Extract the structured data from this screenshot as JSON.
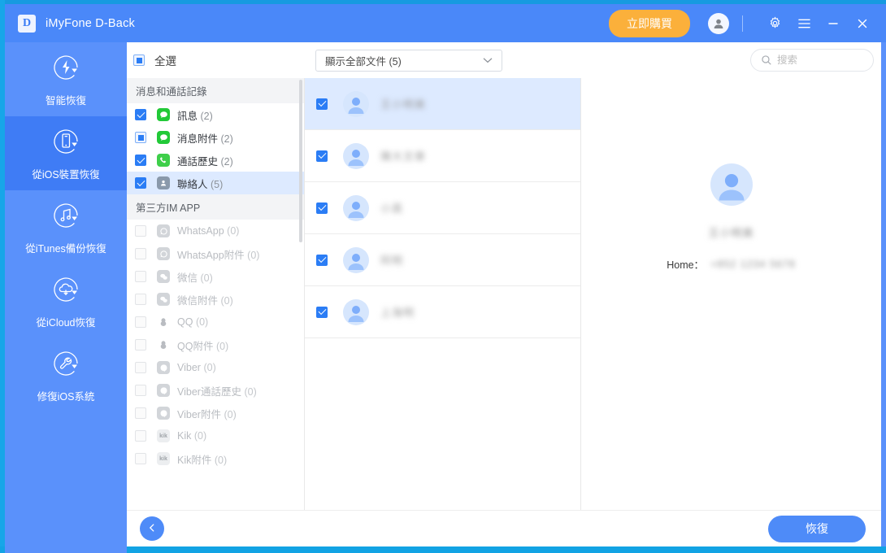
{
  "window": {
    "app_title": "iMyFone D-Back",
    "logo_letter": "D",
    "buy_label": "立即購買",
    "account_icon": "account-icon",
    "settings_icon": "gear-icon",
    "menu_icon": "menu-icon",
    "minimize_icon": "minimize-icon",
    "close_icon": "close-icon"
  },
  "sidebar": {
    "items": [
      {
        "label": "智能恢復",
        "icon": "smart-recovery-icon",
        "active": false
      },
      {
        "label": "從iOS裝置恢復",
        "icon": "ios-device-icon",
        "active": true
      },
      {
        "label": "從iTunes備份恢復",
        "icon": "itunes-backup-icon",
        "active": false
      },
      {
        "label": "從iCloud恢復",
        "icon": "icloud-icon",
        "active": false
      },
      {
        "label": "修復iOS系統",
        "icon": "repair-wrench-icon",
        "active": false
      }
    ]
  },
  "toolbar": {
    "select_all_label": "全選",
    "select_all_state": "indeterminate",
    "filter_label": "顯示全部文件 (5)",
    "filter_caret_icon": "chevron-down-icon",
    "search_placeholder": "搜索",
    "search_value": "",
    "search_icon": "search-icon"
  },
  "file_types": {
    "groups": [
      {
        "title": "消息和通話記錄",
        "rows": [
          {
            "label": "訊息",
            "count": "(2)",
            "state": "checked",
            "disabled": false,
            "selected": false,
            "icon": "message-bubble-icon",
            "icon_color": "#22c938"
          },
          {
            "label": "消息附件",
            "count": "(2)",
            "state": "indeterminate",
            "disabled": false,
            "selected": false,
            "icon": "message-bubble-icon",
            "icon_color": "#22c938"
          },
          {
            "label": "通話歷史",
            "count": "(2)",
            "state": "checked",
            "disabled": false,
            "selected": false,
            "icon": "phone-icon",
            "icon_color": "#3ecf4a"
          },
          {
            "label": "聯絡人",
            "count": "(5)",
            "state": "checked",
            "disabled": false,
            "selected": true,
            "icon": "contacts-icon",
            "icon_color": "#8a99ab"
          }
        ]
      },
      {
        "title": "第三方IM APP",
        "rows": [
          {
            "label": "WhatsApp",
            "count": "(0)",
            "state": "off",
            "disabled": true,
            "selected": false,
            "icon": "whatsapp-icon",
            "icon_color": "#c9ccd1"
          },
          {
            "label": "WhatsApp附件",
            "count": "(0)",
            "state": "off",
            "disabled": true,
            "selected": false,
            "icon": "whatsapp-icon",
            "icon_color": "#c9ccd1"
          },
          {
            "label": "微信",
            "count": "(0)",
            "state": "off",
            "disabled": true,
            "selected": false,
            "icon": "wechat-icon",
            "icon_color": "#c9ccd1"
          },
          {
            "label": "微信附件",
            "count": "(0)",
            "state": "off",
            "disabled": true,
            "selected": false,
            "icon": "wechat-icon",
            "icon_color": "#c9ccd1"
          },
          {
            "label": "QQ",
            "count": "(0)",
            "state": "off",
            "disabled": true,
            "selected": false,
            "icon": "qq-penguin-icon",
            "icon_color": "#b9bcc1"
          },
          {
            "label": "QQ附件",
            "count": "(0)",
            "state": "off",
            "disabled": true,
            "selected": false,
            "icon": "qq-penguin-icon",
            "icon_color": "#b9bcc1"
          },
          {
            "label": "Viber",
            "count": "(0)",
            "state": "off",
            "disabled": true,
            "selected": false,
            "icon": "viber-icon",
            "icon_color": "#c9ccd1"
          },
          {
            "label": "Viber通話歷史",
            "count": "(0)",
            "state": "off",
            "disabled": true,
            "selected": false,
            "icon": "viber-icon",
            "icon_color": "#c9ccd1"
          },
          {
            "label": "Viber附件",
            "count": "(0)",
            "state": "off",
            "disabled": true,
            "selected": false,
            "icon": "viber-icon",
            "icon_color": "#c9ccd1"
          },
          {
            "label": "Kik",
            "count": "(0)",
            "state": "off",
            "disabled": true,
            "selected": false,
            "icon": "kik-icon",
            "icon_color": "#cfd2d6"
          },
          {
            "label": "Kik附件",
            "count": "(0)",
            "state": "off",
            "disabled": true,
            "selected": false,
            "icon": "kik-icon",
            "icon_color": "#cfd2d6"
          }
        ]
      }
    ]
  },
  "contacts": {
    "rows": [
      {
        "name": "王小明美",
        "state": "checked",
        "selected": true,
        "avatar": "avatar-icon"
      },
      {
        "name": "陳大文章",
        "state": "checked",
        "selected": false,
        "avatar": "avatar-icon"
      },
      {
        "name": "小英",
        "state": "checked",
        "selected": false,
        "avatar": "avatar-icon"
      },
      {
        "name": "阿明",
        "state": "checked",
        "selected": false,
        "avatar": "avatar-icon"
      },
      {
        "name": "上海明",
        "state": "checked",
        "selected": false,
        "avatar": "avatar-icon"
      }
    ]
  },
  "detail": {
    "avatar": "avatar-large-icon",
    "name": "王小明美",
    "field_label": "Home：",
    "field_value": "+852 1234 5678"
  },
  "footer": {
    "back_icon": "arrow-left-icon",
    "restore_label": "恢復"
  },
  "colors": {
    "brand_blue": "#4a88f9",
    "sidebar_blue": "#5a91fb",
    "sidebar_active": "#3f7cf5",
    "accent_orange": "#fbb03b",
    "select_row": "#ddeaff",
    "checkbox_blue": "#2b7df5",
    "edge_cyan": "#17a6e8"
  }
}
